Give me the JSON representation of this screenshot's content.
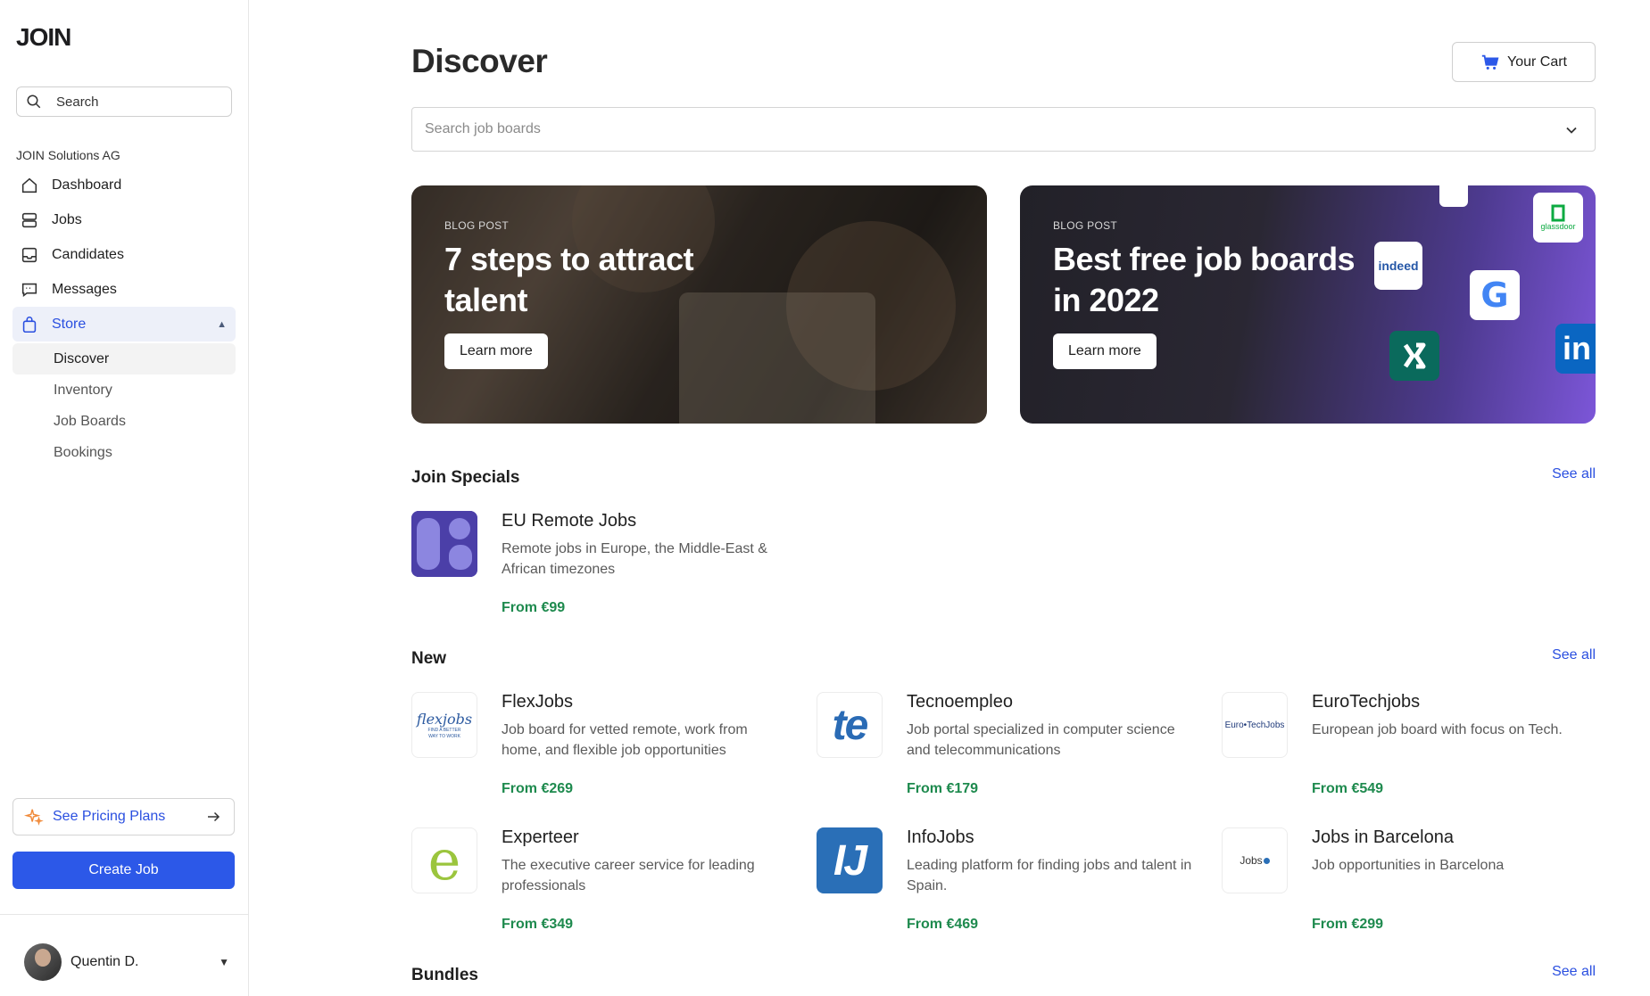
{
  "sidebar": {
    "logo": "JOIN",
    "search_placeholder": "Search",
    "org": "JOIN Solutions AG",
    "nav": [
      {
        "label": "Dashboard",
        "icon": "home-icon"
      },
      {
        "label": "Jobs",
        "icon": "jobs-icon"
      },
      {
        "label": "Candidates",
        "icon": "inbox-icon"
      },
      {
        "label": "Messages",
        "icon": "chat-icon"
      },
      {
        "label": "Store",
        "icon": "bag-icon"
      }
    ],
    "store_sub": [
      "Discover",
      "Inventory",
      "Job Boards",
      "Bookings"
    ],
    "pricing_label": "See Pricing Plans",
    "create_label": "Create Job",
    "user_name": "Quentin D."
  },
  "header": {
    "title": "Discover",
    "cart_label": "Your Cart",
    "board_search_placeholder": "Search job boards"
  },
  "banners": [
    {
      "tag": "BLOG POST",
      "headline": "7 steps to attract talent",
      "cta": "Learn more"
    },
    {
      "tag": "BLOG POST",
      "headline": "Best free job boards in 2022",
      "cta": "Learn more"
    }
  ],
  "banner_logos": [
    "indeed",
    "glassdoor",
    "G",
    "in"
  ],
  "sections": {
    "specials": {
      "title": "Join Specials",
      "see_all": "See all"
    },
    "new": {
      "title": "New",
      "see_all": "See all"
    },
    "bundles": {
      "title": "Bundles",
      "see_all": "See all"
    }
  },
  "specials": [
    {
      "name": "EU Remote Jobs",
      "desc": "Remote jobs in Europe, the Middle-East & African timezones",
      "price": "From €99"
    }
  ],
  "new_boards": [
    {
      "name": "FlexJobs",
      "desc": "Job board for vetted remote, work from home, and flexible job opportunities",
      "price": "From €269",
      "logo_text": "flexjobs",
      "logo_sub": "FIND A BETTER WAY TO WORK"
    },
    {
      "name": "Tecnoempleo",
      "desc": "Job portal specialized in computer science and telecommunications",
      "price": "From €179",
      "logo_text": "te"
    },
    {
      "name": "EuroTechjobs",
      "desc": "European job board with focus on Tech.",
      "price": "From €549",
      "logo_text": "Euro•TechJobs"
    },
    {
      "name": "Experteer",
      "desc": "The executive career service for leading professionals",
      "price": "From €349",
      "logo_text": "e"
    },
    {
      "name": "InfoJobs",
      "desc": "Leading platform for finding jobs and talent in Spain.",
      "price": "From €469",
      "logo_text": "IJ"
    },
    {
      "name": "Jobs in Barcelona",
      "desc": "Job opportunities in Barcelona",
      "price": "From €299",
      "logo_text": "Jobs"
    }
  ],
  "colors": {
    "accent": "#2c58e8",
    "price": "#1e8a4e",
    "active_nav_bg": "#edf0f9"
  }
}
